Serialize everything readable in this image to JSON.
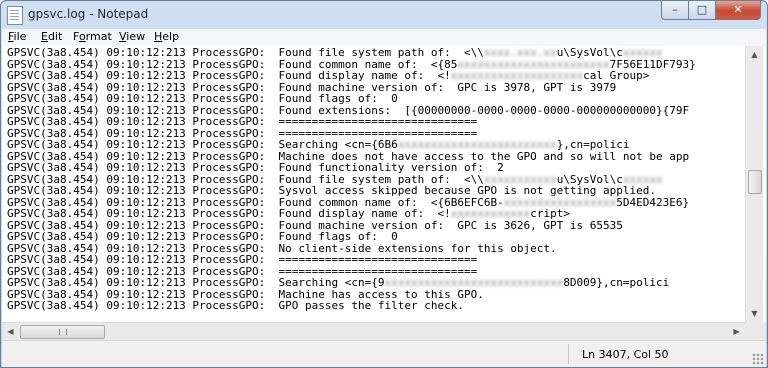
{
  "window": {
    "title": "gpsvc.log - Notepad",
    "buttons": {
      "minimize": "–",
      "maximize": "□",
      "close": "✕"
    },
    "icon": "notepad-icon"
  },
  "menu": [
    {
      "accel": "F",
      "rest": "ile"
    },
    {
      "accel": "E",
      "rest": "dit"
    },
    {
      "accel": "o",
      "pre": "F",
      "rest": "rmat"
    },
    {
      "accel": "V",
      "rest": "iew"
    },
    {
      "accel": "H",
      "rest": "elp"
    }
  ],
  "lines": [
    {
      "p": "GPSVC(3a8.454) 09:10:12:213 ProcessGPO:  Found file system path of:  <\\\\",
      "b": "xxxx.xxx.xx",
      "s": "u\\SysVol\\c",
      "b2": "xxxxxx"
    },
    {
      "p": "GPSVC(3a8.454) 09:10:12:213 ProcessGPO:  Found common name of:  <{85",
      "b": "xxxxxxxxxxxxxxxxxxxxxxx",
      "s": "7F56E11DF793}"
    },
    {
      "p": "GPSVC(3a8.454) 09:10:12:213 ProcessGPO:  Found display name of:  <!",
      "b": "xxxxxxxxxxxxxxxxxxxx",
      "s": "cal Group>"
    },
    {
      "p": "GPSVC(3a8.454) 09:10:12:213 ProcessGPO:  Found machine version of:  GPC is 3978, GPT is 3979"
    },
    {
      "p": "GPSVC(3a8.454) 09:10:12:213 ProcessGPO:  Found flags of:  0"
    },
    {
      "p": "GPSVC(3a8.454) 09:10:12:213 ProcessGPO:  Found extensions:  [{00000000-0000-0000-0000-000000000000}{79F"
    },
    {
      "p": "GPSVC(3a8.454) 09:10:12:213 ProcessGPO:  =============================="
    },
    {
      "p": "GPSVC(3a8.454) 09:10:12:213 ProcessGPO:  =============================="
    },
    {
      "p": "GPSVC(3a8.454) 09:10:12:213 ProcessGPO:  Searching <cn={6B6",
      "b": "xxxxxxxxxxxxxxxxxxxxxxxx",
      "s": "},cn=polici"
    },
    {
      "p": "GPSVC(3a8.454) 09:10:12:213 ProcessGPO:  Machine does not have access to the GPO and so will not be app"
    },
    {
      "p": "GPSVC(3a8.454) 09:10:12:213 ProcessGPO:  Found functionality version of:  2"
    },
    {
      "p": "GPSVC(3a8.454) 09:10:12:213 ProcessGPO:  Found file system path of:  <\\\\",
      "b": "xxxxxxxxxxx",
      "s": "u\\SysVol\\c",
      "b2": "xxxxxx"
    },
    {
      "p": "GPSVC(3a8.454) 09:10:12:213 ProcessGPO:  Sysvol access skipped because GPO is not getting applied."
    },
    {
      "p": "GPSVC(3a8.454) 09:10:12:213 ProcessGPO:  Found common name of:  <{6B6EFC6B-",
      "b": "xxxxxxxxxxxxxxxxx",
      "s": "5D4ED423E6}"
    },
    {
      "p": "GPSVC(3a8.454) 09:10:12:213 ProcessGPO:  Found display name of:  <!",
      "b": "xxxxxxxxxxxx",
      "s": "cript>"
    },
    {
      "p": "GPSVC(3a8.454) 09:10:12:213 ProcessGPO:  Found machine version of:  GPC is 3626, GPT is 65535"
    },
    {
      "p": "GPSVC(3a8.454) 09:10:12:213 ProcessGPO:  Found flags of:  0"
    },
    {
      "p": "GPSVC(3a8.454) 09:10:12:213 ProcessGPO:  No client-side extensions for this object."
    },
    {
      "p": "GPSVC(3a8.454) 09:10:12:213 ProcessGPO:  =============================="
    },
    {
      "p": "GPSVC(3a8.454) 09:10:12:213 ProcessGPO:  =============================="
    },
    {
      "p": "GPSVC(3a8.454) 09:10:12:213 ProcessGPO:  Searching <cn={9",
      "b": "xxxxxxxxxxxxxxxxxxxxxxxxxxx",
      "s": "8D009},cn=polici"
    },
    {
      "p": "GPSVC(3a8.454) 09:10:12:213 ProcessGPO:  Machine has access to this GPO."
    },
    {
      "p": "GPSVC(3a8.454) 09:10:12:213 ProcessGPO:  GPO passes the filter check."
    }
  ],
  "status": {
    "position": "Ln 3407, Col 50"
  },
  "scrollbar": {
    "grip_icon": "grip-icon"
  }
}
